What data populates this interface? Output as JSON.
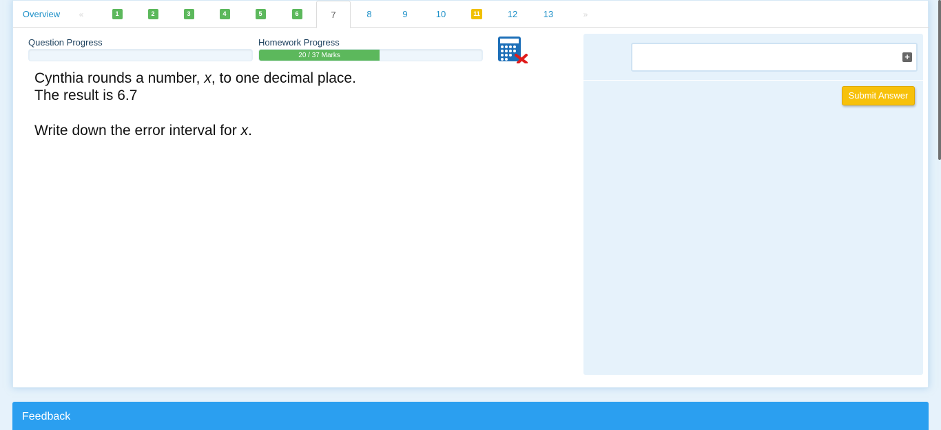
{
  "tabs": {
    "overview": "Overview",
    "prev_arrow": "«",
    "next_arrow": "»",
    "items": [
      {
        "label": "1",
        "state": "done"
      },
      {
        "label": "2",
        "state": "done"
      },
      {
        "label": "3",
        "state": "done"
      },
      {
        "label": "4",
        "state": "done"
      },
      {
        "label": "5",
        "state": "done"
      },
      {
        "label": "6",
        "state": "done"
      },
      {
        "label": "7",
        "state": "active"
      },
      {
        "label": "8",
        "state": "todo"
      },
      {
        "label": "9",
        "state": "todo"
      },
      {
        "label": "10",
        "state": "todo"
      },
      {
        "label": "11",
        "state": "partial"
      },
      {
        "label": "12",
        "state": "todo"
      },
      {
        "label": "13",
        "state": "todo"
      }
    ]
  },
  "progress": {
    "question_label": "Question Progress",
    "question_fraction": 0,
    "homework_label": "Homework Progress",
    "homework_text": "20 / 37 Marks",
    "homework_marks": 20,
    "homework_total": 37
  },
  "question": {
    "line1_a": "Cynthia rounds a number, ",
    "line1_var": "x",
    "line1_b": ", to one decimal place.",
    "line2": "The result is 6.7",
    "line3_a": "Write down the error interval for ",
    "line3_var": "x",
    "line3_b": "."
  },
  "answer": {
    "value": "",
    "submit_label": "Submit Answer"
  },
  "feedback": {
    "title": "Feedback"
  },
  "colors": {
    "green": "#5cb85c",
    "yellow": "#f0c000",
    "link": "#1e90c8",
    "feedback_bar": "#2b9ff0",
    "submit": "#f7c10a"
  },
  "icons": {
    "calculator": "calculator-disabled-icon",
    "plus": "plus-square-icon"
  }
}
